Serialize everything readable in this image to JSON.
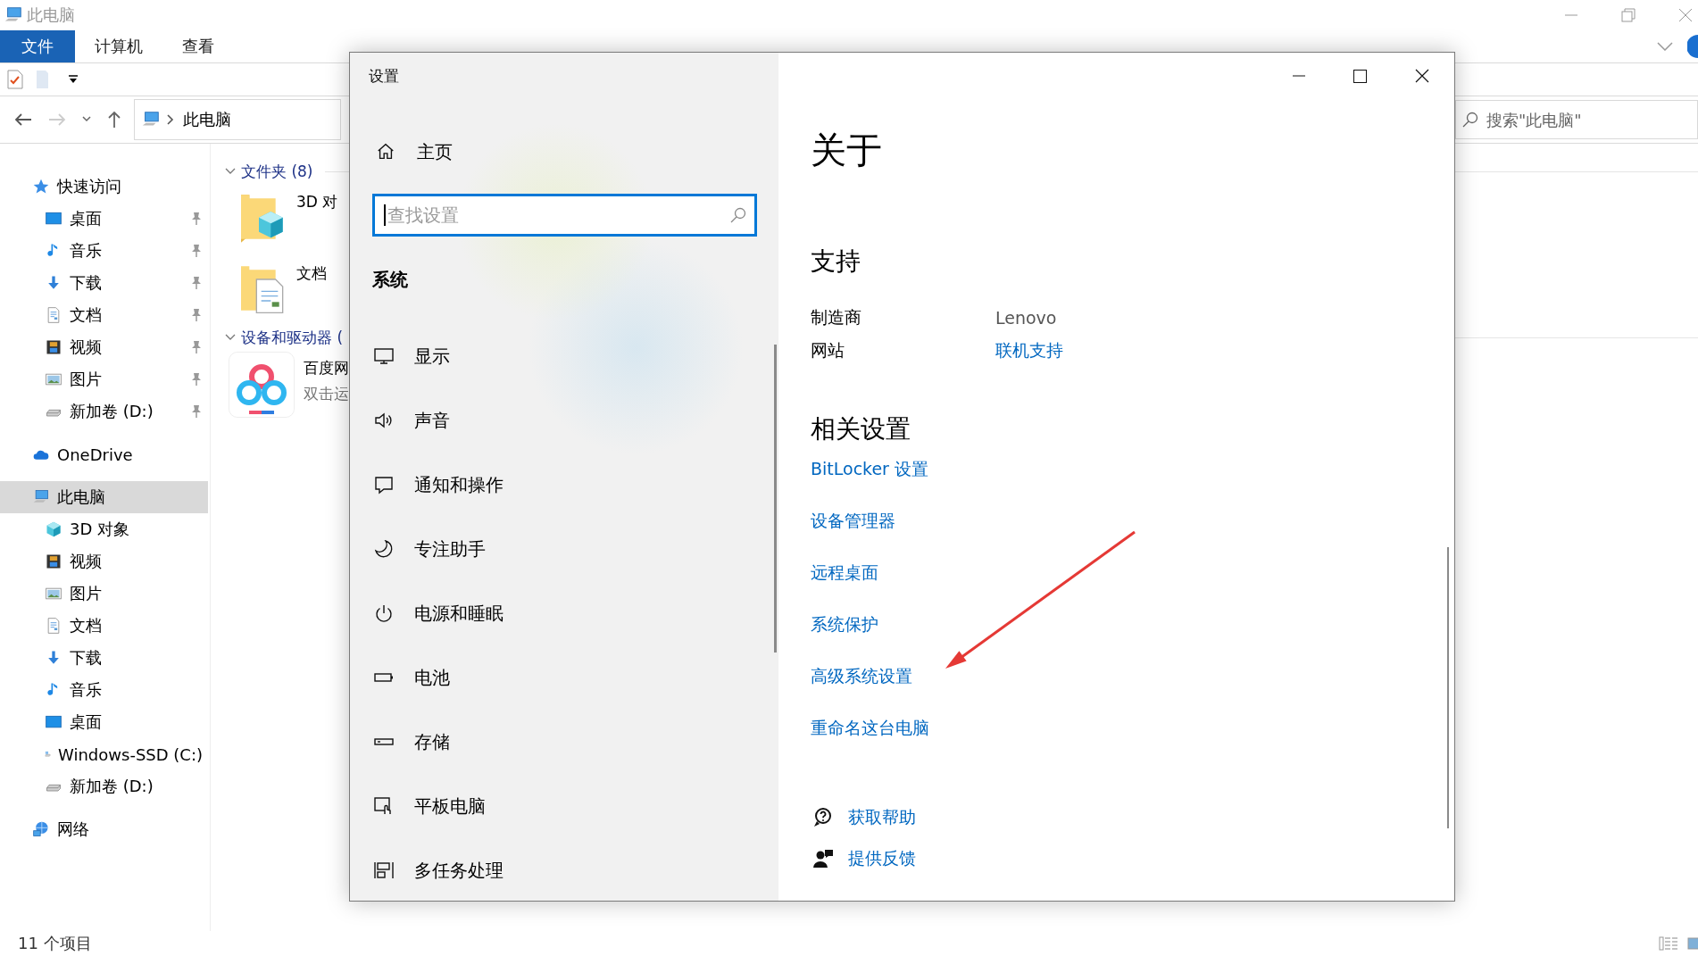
{
  "explorer": {
    "title": "此电脑",
    "ribbon_tabs": [
      {
        "label": "文件",
        "selected": true
      },
      {
        "label": "计算机",
        "selected": false
      },
      {
        "label": "查看",
        "selected": false
      }
    ],
    "address": {
      "path": "此电脑"
    },
    "search": {
      "placeholder": "搜索\"此电脑\""
    },
    "nav": [
      {
        "label": "快速访问",
        "kind": "star",
        "selected": false,
        "children": [
          {
            "label": "桌面",
            "kind": "desktop",
            "selected": false,
            "pinned": true
          },
          {
            "label": "音乐",
            "kind": "music",
            "selected": false,
            "pinned": true
          },
          {
            "label": "下载",
            "kind": "download",
            "selected": false,
            "pinned": true
          },
          {
            "label": "文档",
            "kind": "doc",
            "selected": false,
            "pinned": true
          },
          {
            "label": "视频",
            "kind": "video",
            "selected": false,
            "pinned": true
          },
          {
            "label": "图片",
            "kind": "pictures",
            "selected": false,
            "pinned": true
          },
          {
            "label": "新加卷 (D:)",
            "kind": "drive",
            "selected": false,
            "pinned": true
          }
        ]
      },
      {
        "label": "OneDrive",
        "kind": "cloud",
        "selected": false
      },
      {
        "label": "此电脑",
        "kind": "pc",
        "selected": true,
        "children": [
          {
            "label": "3D 对象",
            "kind": "cube",
            "selected": false,
            "pinned": false
          },
          {
            "label": "视频",
            "kind": "video",
            "selected": false,
            "pinned": false
          },
          {
            "label": "图片",
            "kind": "pictures",
            "selected": false,
            "pinned": false
          },
          {
            "label": "文档",
            "kind": "doc",
            "selected": false,
            "pinned": false
          },
          {
            "label": "下载",
            "kind": "download",
            "selected": false,
            "pinned": false
          },
          {
            "label": "音乐",
            "kind": "music",
            "selected": false,
            "pinned": false
          },
          {
            "label": "桌面",
            "kind": "desktop",
            "selected": false,
            "pinned": false
          },
          {
            "label": "Windows-SSD (C:)",
            "kind": "winssd",
            "selected": false,
            "pinned": false
          },
          {
            "label": "新加卷 (D:)",
            "kind": "drive",
            "selected": false,
            "pinned": false
          }
        ]
      },
      {
        "label": "网络",
        "kind": "network",
        "selected": false
      }
    ],
    "groups": [
      {
        "label": "文件夹 (8)",
        "items": [
          {
            "name": "3D 对",
            "kind": "folder3d"
          },
          {
            "name": "文档",
            "kind": "folderdoc"
          }
        ]
      },
      {
        "label": "设备和驱动器 (",
        "items": [
          {
            "name": "百度网",
            "detail": "双击运",
            "kind": "app"
          }
        ]
      }
    ],
    "status_bar": "11 个项目"
  },
  "settings": {
    "title": "设置",
    "home": {
      "label": "主页"
    },
    "search": {
      "placeholder": "查找设置"
    },
    "section": "系统",
    "nav": [
      {
        "label": "显示",
        "kind": "display",
        "selected": false
      },
      {
        "label": "声音",
        "kind": "sound",
        "selected": false
      },
      {
        "label": "通知和操作",
        "kind": "notify",
        "selected": false
      },
      {
        "label": "专注助手",
        "kind": "focus",
        "selected": false
      },
      {
        "label": "电源和睡眠",
        "kind": "power",
        "selected": false
      },
      {
        "label": "电池",
        "kind": "battery",
        "selected": false
      },
      {
        "label": "存储",
        "kind": "storage",
        "selected": false
      },
      {
        "label": "平板电脑",
        "kind": "tablet",
        "selected": false
      },
      {
        "label": "多任务处理",
        "kind": "multitask",
        "selected": false
      }
    ],
    "page_title": "关于",
    "support": {
      "heading": "支持",
      "rows": [
        {
          "label": "制造商",
          "value": "Lenovo",
          "kind": "text"
        },
        {
          "label": "网站",
          "value": "联机支持",
          "kind": "link"
        }
      ]
    },
    "related": {
      "heading": "相关设置",
      "links": [
        {
          "label": "BitLocker 设置"
        },
        {
          "label": "设备管理器"
        },
        {
          "label": "远程桌面"
        },
        {
          "label": "系统保护"
        },
        {
          "label": "高级系统设置"
        },
        {
          "label": "重命名这台电脑"
        }
      ]
    },
    "help_links": [
      {
        "label": "获取帮助",
        "kind": "help"
      },
      {
        "label": "提供反馈",
        "kind": "feedback"
      }
    ]
  }
}
